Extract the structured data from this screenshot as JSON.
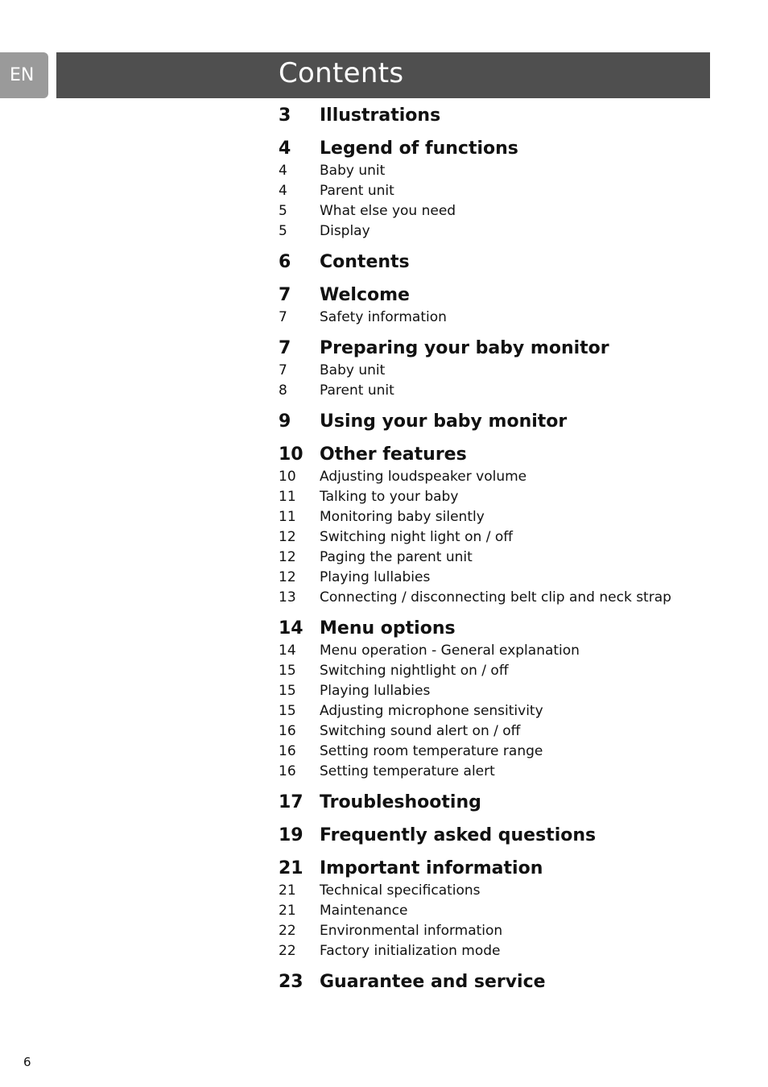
{
  "language_tab": "EN",
  "title": "Contents",
  "page_number": "6",
  "sections": [
    {
      "page": "3",
      "title": "Illustrations",
      "items": []
    },
    {
      "page": "4",
      "title": "Legend of functions",
      "items": [
        {
          "page": "4",
          "title": "Baby unit"
        },
        {
          "page": "4",
          "title": "Parent unit"
        },
        {
          "page": "5",
          "title": "What else you need"
        },
        {
          "page": "5",
          "title": "Display"
        }
      ]
    },
    {
      "page": "6",
      "title": "Contents",
      "items": []
    },
    {
      "page": "7",
      "title": "Welcome",
      "items": [
        {
          "page": "7",
          "title": "Safety information"
        }
      ]
    },
    {
      "page": "7",
      "title": "Preparing your baby monitor",
      "items": [
        {
          "page": "7",
          "title": "Baby unit"
        },
        {
          "page": "8",
          "title": "Parent unit"
        }
      ]
    },
    {
      "page": "9",
      "title": "Using your baby monitor",
      "items": []
    },
    {
      "page": "10",
      "title": "Other features",
      "items": [
        {
          "page": "10",
          "title": "Adjusting loudspeaker volume"
        },
        {
          "page": "11",
          "title": "Talking to your baby"
        },
        {
          "page": "11",
          "title": "Monitoring baby silently"
        },
        {
          "page": "12",
          "title": "Switching night light on / off"
        },
        {
          "page": "12",
          "title": "Paging the parent unit"
        },
        {
          "page": "12",
          "title": "Playing lullabies"
        },
        {
          "page": "13",
          "title": "Connecting / disconnecting belt clip and neck strap"
        }
      ]
    },
    {
      "page": "14",
      "title": "Menu options",
      "items": [
        {
          "page": "14",
          "title": "Menu operation - General explanation"
        },
        {
          "page": "15",
          "title": "Switching nightlight on / off"
        },
        {
          "page": "15",
          "title": "Playing lullabies"
        },
        {
          "page": "15",
          "title": "Adjusting microphone sensitivity"
        },
        {
          "page": "16",
          "title": "Switching sound alert on / off"
        },
        {
          "page": "16",
          "title": "Setting room temperature range"
        },
        {
          "page": "16",
          "title": "Setting temperature alert"
        }
      ]
    },
    {
      "page": "17",
      "title": "Troubleshooting",
      "items": []
    },
    {
      "page": "19",
      "title": "Frequently asked questions",
      "items": []
    },
    {
      "page": "21",
      "title": "Important information",
      "items": [
        {
          "page": "21",
          "title": "Technical specifications"
        },
        {
          "page": "21",
          "title": "Maintenance"
        },
        {
          "page": "22",
          "title": "Environmental information"
        },
        {
          "page": "22",
          "title": "Factory initialization mode"
        }
      ]
    },
    {
      "page": "23",
      "title": "Guarantee and service",
      "items": []
    }
  ]
}
